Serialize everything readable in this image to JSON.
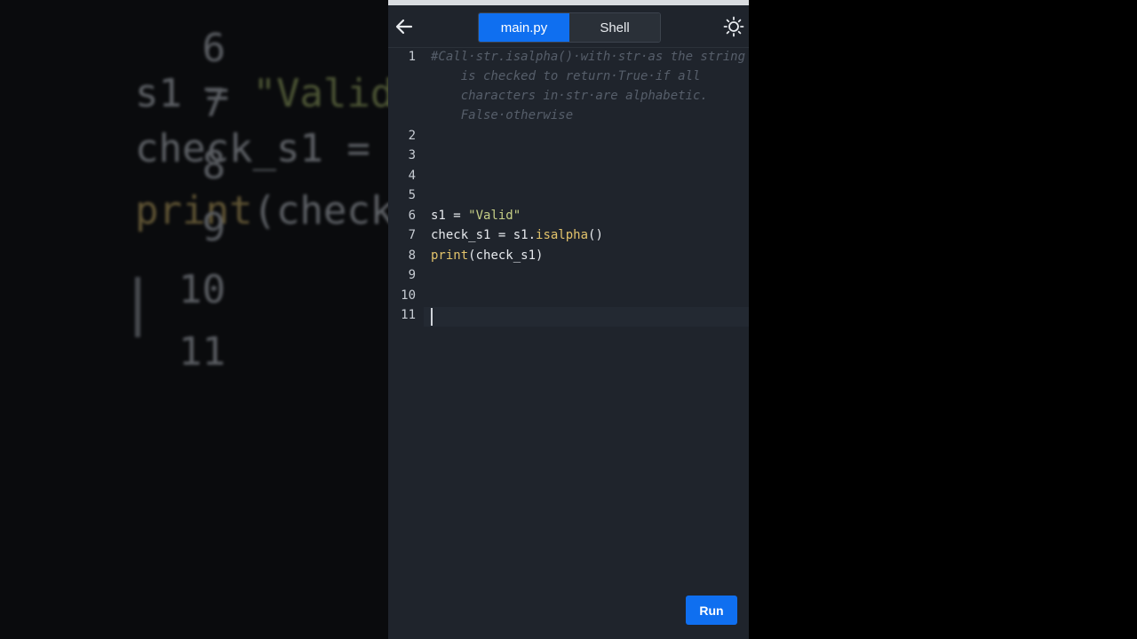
{
  "tabs": [
    {
      "label": "main.py",
      "active": true
    },
    {
      "label": "Shell",
      "active": false
    }
  ],
  "icons": {
    "back": "arrow-left-icon",
    "theme": "sun-icon"
  },
  "editor": {
    "line_numbers": [
      "1",
      "2",
      "3",
      "4",
      "5",
      "6",
      "7",
      "8",
      "9",
      "10",
      "11"
    ],
    "comment_lines": [
      "#Call·str.isalpha()·with·str·as the string",
      "    is checked to return·True·if all",
      "    characters in·str·are alphabetic.",
      "    False·otherwise"
    ],
    "line6": {
      "var": "s1 = ",
      "str": "\"Valid\""
    },
    "line7": {
      "a": "check_s1 = s1.",
      "fn": "isalpha",
      "b": "()"
    },
    "line8": {
      "fn": "print",
      "b": "(check_s1)"
    }
  },
  "background_zoom": {
    "line_numbers": [
      "6",
      "7",
      "8",
      "9",
      "10",
      "11"
    ],
    "line6": {
      "a": "s1 = ",
      "b": "\"Valid\""
    },
    "line7": "check_s1 = ",
    "line8": {
      "fn": "print",
      "b": "(check"
    }
  },
  "run_label": "Run",
  "colors": {
    "accent": "#0f6ff0",
    "editor_bg": "#1f242c"
  }
}
